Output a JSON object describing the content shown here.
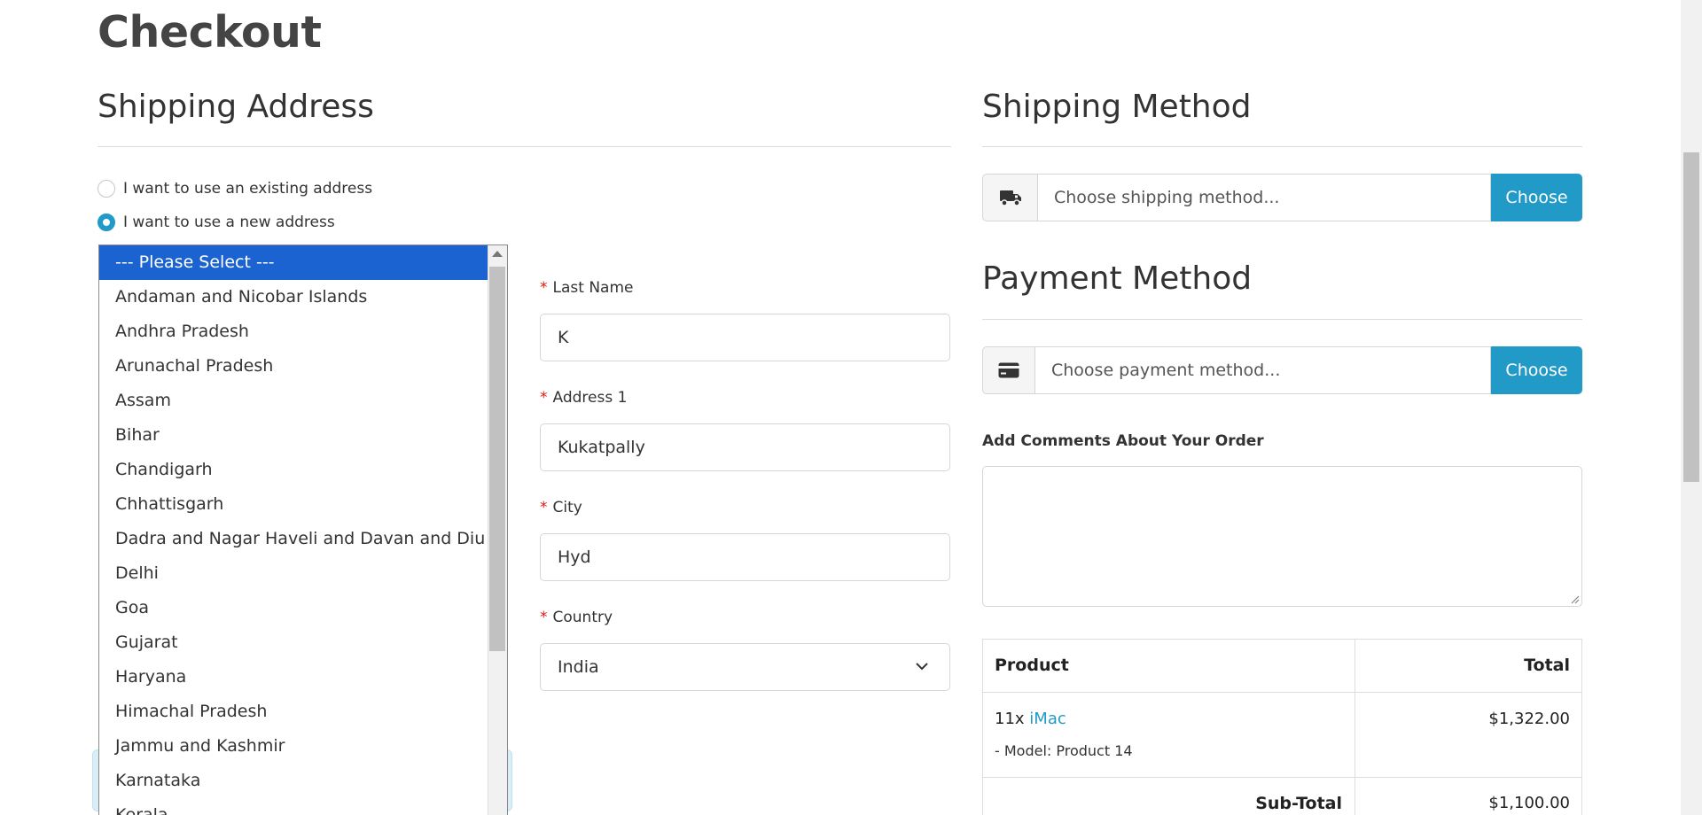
{
  "page": {
    "title": "Checkout"
  },
  "shipping_address": {
    "title": "Shipping Address",
    "radio_existing": "I want to use an existing address",
    "radio_new": "I want to use a new address",
    "selected_option": "new"
  },
  "form": {
    "last_name": {
      "label": "Last Name",
      "value": "K"
    },
    "address1": {
      "label": "Address 1",
      "value": "Kukatpally"
    },
    "city": {
      "label": "City",
      "value": "Hyd"
    },
    "country": {
      "label": "Country",
      "value": "India"
    }
  },
  "region_list": {
    "selected_index": 0,
    "options": [
      "--- Please Select ---",
      "Andaman and Nicobar Islands",
      "Andhra Pradesh",
      "Arunachal Pradesh",
      "Assam",
      "Bihar",
      "Chandigarh",
      "Chhattisgarh",
      "Dadra and Nagar Haveli and Davan and Diu",
      "Delhi",
      "Goa",
      "Gujarat",
      "Haryana",
      "Himachal Pradesh",
      "Jammu and Kashmir",
      "Karnataka",
      "Kerala"
    ]
  },
  "shipping_method": {
    "title": "Shipping Method",
    "placeholder": "Choose shipping method...",
    "button": "Choose",
    "icon": "truck-icon"
  },
  "payment_method": {
    "title": "Payment Method",
    "placeholder": "Choose payment method...",
    "button": "Choose",
    "icon": "credit-card-icon"
  },
  "comments": {
    "label": "Add Comments About Your Order",
    "value": ""
  },
  "order_table": {
    "headers": {
      "product": "Product",
      "total": "Total"
    },
    "item": {
      "quantity": "11x",
      "name": "iMac",
      "option": "- Model: Product 14",
      "total": "$1,322.00"
    },
    "subtotal": {
      "label": "Sub-Total",
      "value": "$1,100.00"
    }
  },
  "colors": {
    "accent": "#229ac8",
    "selected_option_bg": "#1a63d1",
    "required": "#e0180c"
  }
}
